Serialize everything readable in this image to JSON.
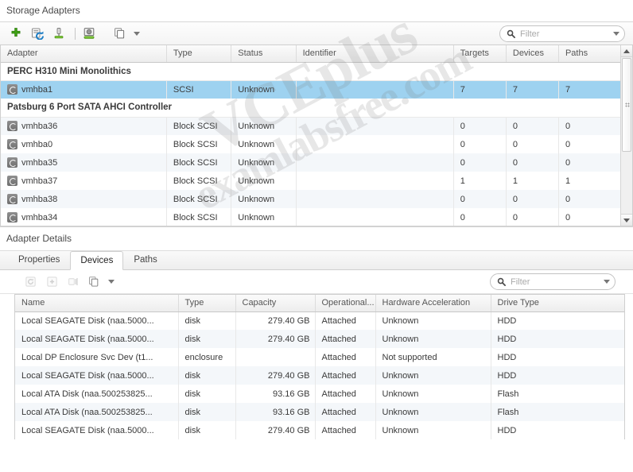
{
  "adapters_panel": {
    "title": "Storage Adapters",
    "toolbar": {
      "add_label": "Add Storage Adapter",
      "refresh_label": "Rescan Storage",
      "rescan_adapter_label": "Rescan Adapter",
      "properties_label": "Adapter Properties",
      "copy_label": "Copy to Clipboard"
    },
    "filter": {
      "placeholder": "Filter",
      "value": ""
    },
    "columns": [
      "Adapter",
      "Type",
      "Status",
      "Identifier",
      "Targets",
      "Devices",
      "Paths"
    ],
    "rows": [
      {
        "kind": "group",
        "adapter": "PERC H310 Mini Monolithics"
      },
      {
        "kind": "item",
        "adapter": "vmhba1",
        "type": "SCSI",
        "status": "Unknown",
        "identifier": "",
        "targets": "7",
        "devices": "7",
        "paths": "7",
        "selected": true
      },
      {
        "kind": "group",
        "adapter": "Patsburg 6 Port SATA AHCI Controller"
      },
      {
        "kind": "item",
        "adapter": "vmhba36",
        "type": "Block SCSI",
        "status": "Unknown",
        "identifier": "",
        "targets": "0",
        "devices": "0",
        "paths": "0",
        "selected": false
      },
      {
        "kind": "item",
        "adapter": "vmhba0",
        "type": "Block SCSI",
        "status": "Unknown",
        "identifier": "",
        "targets": "0",
        "devices": "0",
        "paths": "0",
        "selected": false
      },
      {
        "kind": "item",
        "adapter": "vmhba35",
        "type": "Block SCSI",
        "status": "Unknown",
        "identifier": "",
        "targets": "0",
        "devices": "0",
        "paths": "0",
        "selected": false
      },
      {
        "kind": "item",
        "adapter": "vmhba37",
        "type": "Block SCSI",
        "status": "Unknown",
        "identifier": "",
        "targets": "1",
        "devices": "1",
        "paths": "1",
        "selected": false
      },
      {
        "kind": "item",
        "adapter": "vmhba38",
        "type": "Block SCSI",
        "status": "Unknown",
        "identifier": "",
        "targets": "0",
        "devices": "0",
        "paths": "0",
        "selected": false
      },
      {
        "kind": "item",
        "adapter": "vmhba34",
        "type": "Block SCSI",
        "status": "Unknown",
        "identifier": "",
        "targets": "0",
        "devices": "0",
        "paths": "0",
        "selected": false
      }
    ]
  },
  "details_panel": {
    "title": "Adapter Details",
    "tabs": [
      {
        "label": "Properties",
        "active": false
      },
      {
        "label": "Devices",
        "active": true
      },
      {
        "label": "Paths",
        "active": false
      }
    ],
    "toolbar": {
      "refresh_label": "Refresh",
      "detach_label": "Detach",
      "rename_label": "Rename",
      "copy_label": "Copy to Clipboard"
    },
    "filter": {
      "placeholder": "Filter",
      "value": ""
    },
    "columns": [
      "Name",
      "Type",
      "Capacity",
      "Operational...",
      "Hardware Acceleration",
      "Drive Type"
    ],
    "rows": [
      {
        "name": "Local SEAGATE Disk (naa.5000...",
        "type": "disk",
        "capacity": "279.40 GB",
        "operational": "Attached",
        "hwaccel": "Unknown",
        "drive_type": "HDD"
      },
      {
        "name": "Local SEAGATE Disk (naa.5000...",
        "type": "disk",
        "capacity": "279.40 GB",
        "operational": "Attached",
        "hwaccel": "Unknown",
        "drive_type": "HDD"
      },
      {
        "name": "Local DP Enclosure Svc Dev (t1...",
        "type": "enclosure",
        "capacity": "",
        "operational": "Attached",
        "hwaccel": "Not supported",
        "drive_type": "HDD"
      },
      {
        "name": "Local SEAGATE Disk (naa.5000...",
        "type": "disk",
        "capacity": "279.40 GB",
        "operational": "Attached",
        "hwaccel": "Unknown",
        "drive_type": "HDD"
      },
      {
        "name": "Local ATA Disk (naa.500253825...",
        "type": "disk",
        "capacity": "93.16 GB",
        "operational": "Attached",
        "hwaccel": "Unknown",
        "drive_type": "Flash"
      },
      {
        "name": "Local ATA Disk (naa.500253825...",
        "type": "disk",
        "capacity": "93.16 GB",
        "operational": "Attached",
        "hwaccel": "Unknown",
        "drive_type": "Flash"
      },
      {
        "name": "Local SEAGATE Disk (naa.5000...",
        "type": "disk",
        "capacity": "279.40 GB",
        "operational": "Attached",
        "hwaccel": "Unknown",
        "drive_type": "HDD"
      }
    ]
  },
  "watermark": {
    "line1": "VCEplus",
    "line2": "examlabsfree.com"
  },
  "colors": {
    "selection": "#9ed2f0",
    "stripe": "#f4f7fa",
    "header_text": "#555555",
    "accent_green": "#4caf2a"
  }
}
